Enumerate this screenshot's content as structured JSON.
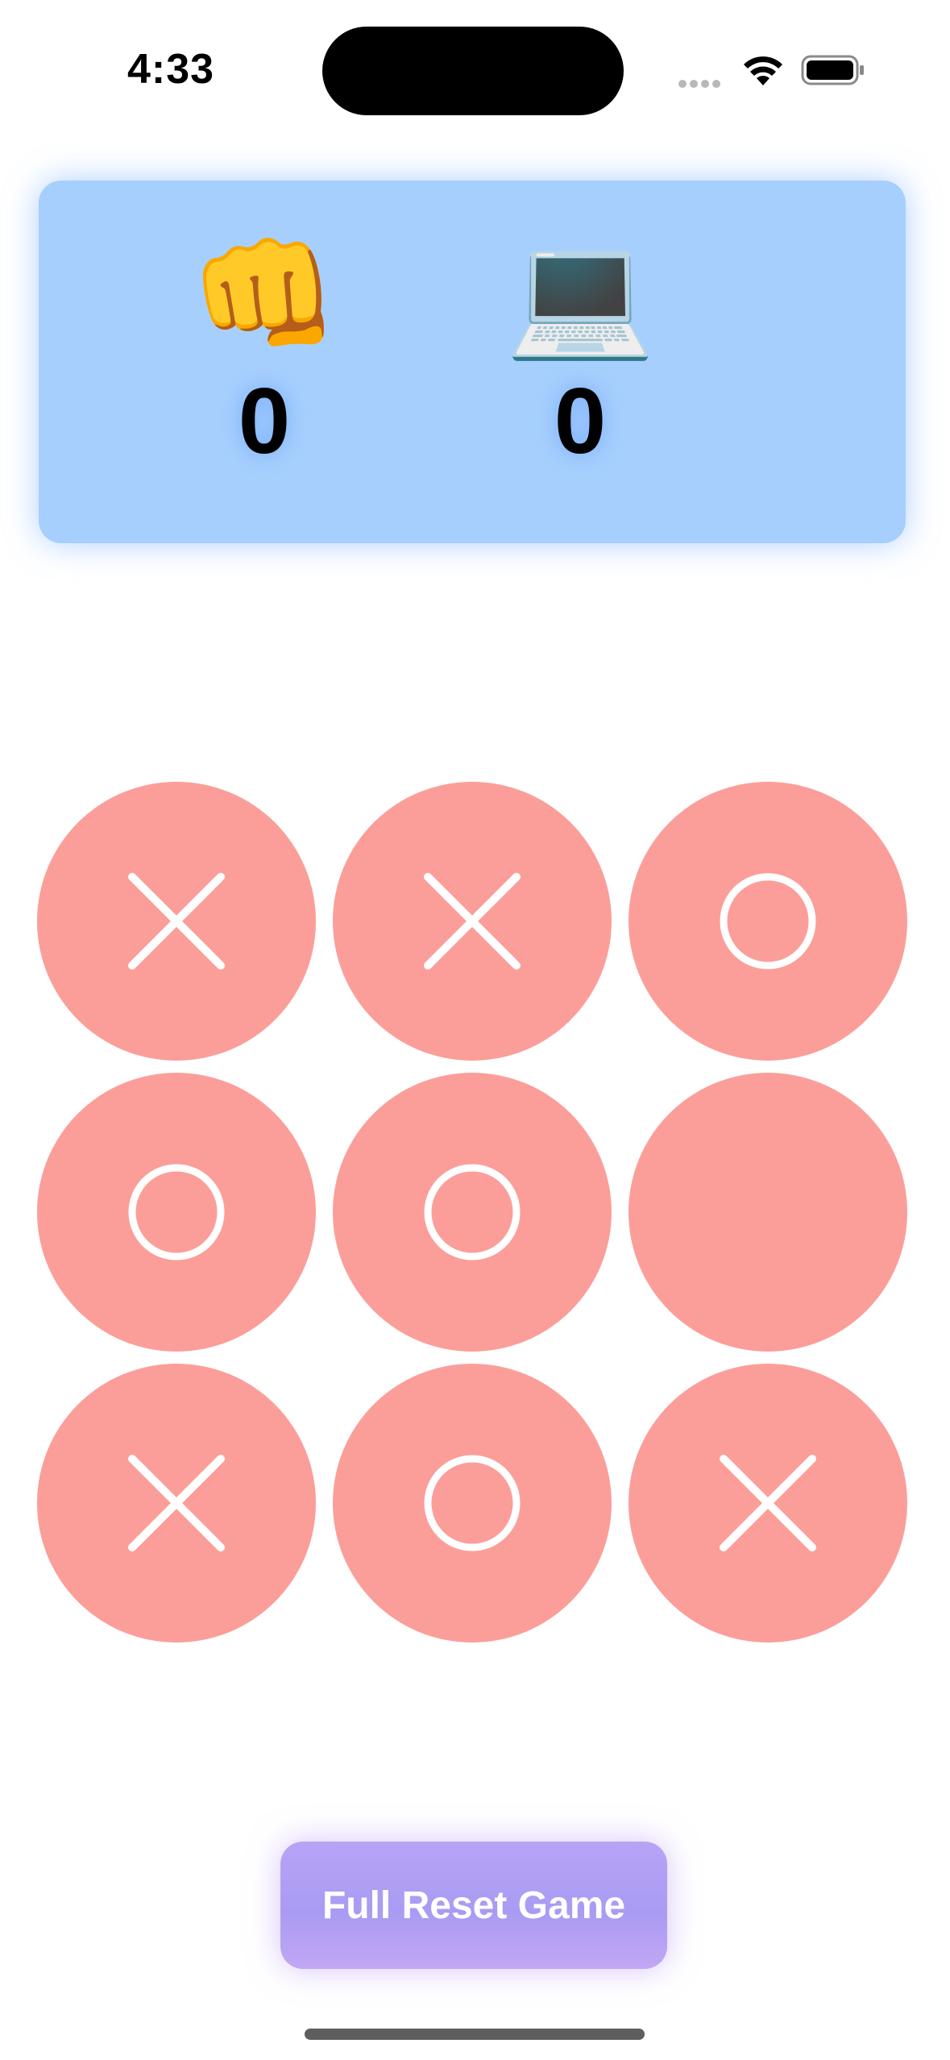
{
  "status_bar": {
    "time": "4:33"
  },
  "scoreboard": {
    "player": {
      "emoji": "👊",
      "icon": "pointing-hand-icon",
      "score": "0"
    },
    "computer": {
      "emoji": "💻",
      "icon": "laptop-icon",
      "score": "0"
    }
  },
  "board": {
    "cells": [
      "X",
      "X",
      "O",
      "O",
      "O",
      "",
      "X",
      "O",
      "X"
    ]
  },
  "reset_button": {
    "label": "Full Reset Game"
  },
  "colors": {
    "panel": "#a6cffd",
    "cell": "#fb9e99",
    "mark": "#ffffff",
    "button": "#ae9df3"
  }
}
